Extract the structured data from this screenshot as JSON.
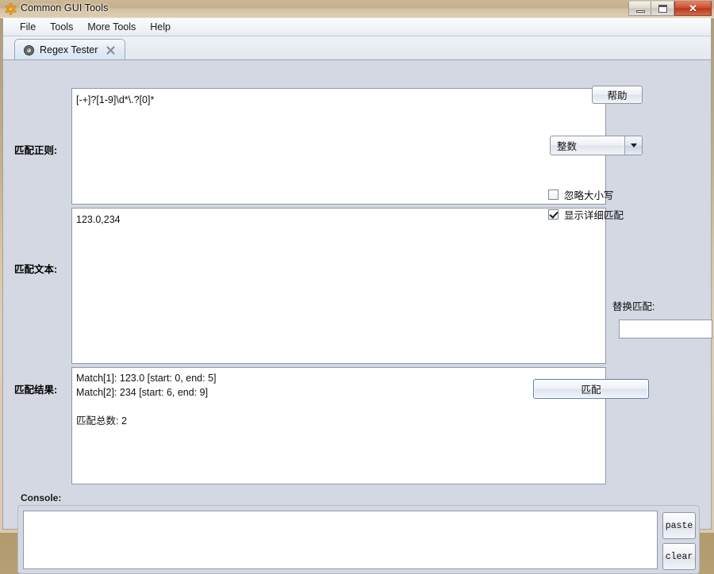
{
  "window": {
    "title": "Common GUI Tools",
    "icon": "asterisk-icon",
    "controls": {
      "minimize": "minimize-icon",
      "maximize": "maximize-icon",
      "close": "✕"
    }
  },
  "menubar": {
    "items": [
      {
        "label": "File"
      },
      {
        "label": "Tools"
      },
      {
        "label": "More Tools"
      },
      {
        "label": "Help"
      }
    ]
  },
  "tabs": [
    {
      "label": "Regex Tester",
      "icon": "regex-tab-icon",
      "close": "close-icon",
      "active": true
    }
  ],
  "main": {
    "labels": {
      "regex": "匹配正则:",
      "subject": "匹配文本:",
      "result": "匹配结果:"
    },
    "regex_input": {
      "value": "[-+]?[1-9]\\d*\\.?[0]*"
    },
    "subject_input": {
      "value": "123.0,234"
    },
    "result_output": {
      "value": "Match[1]: 123.0 [start: 0, end: 5]\nMatch[2]: 234 [start: 6, end: 9]\n\n匹配总数: 2"
    }
  },
  "sidebar": {
    "help_button": "帮助",
    "type_combo": {
      "selected": "整数",
      "arrow": "chevron-down-icon"
    },
    "checkboxes": [
      {
        "label": "忽略大小写",
        "checked": false
      },
      {
        "label": "显示详细匹配",
        "checked": true
      }
    ],
    "replace_label": "替换匹配:",
    "replace_input": {
      "value": ""
    },
    "match_button": "匹配"
  },
  "console": {
    "label": "Console:",
    "output": "",
    "paste_button": "paste",
    "clear_button": "clear"
  },
  "colors": {
    "panel_bg": "#d4d8e2",
    "editor_bg": "#ffffff",
    "accent_border": "#9098a8",
    "close_red": "#cf4f30",
    "desktop": "#c3ae80"
  }
}
